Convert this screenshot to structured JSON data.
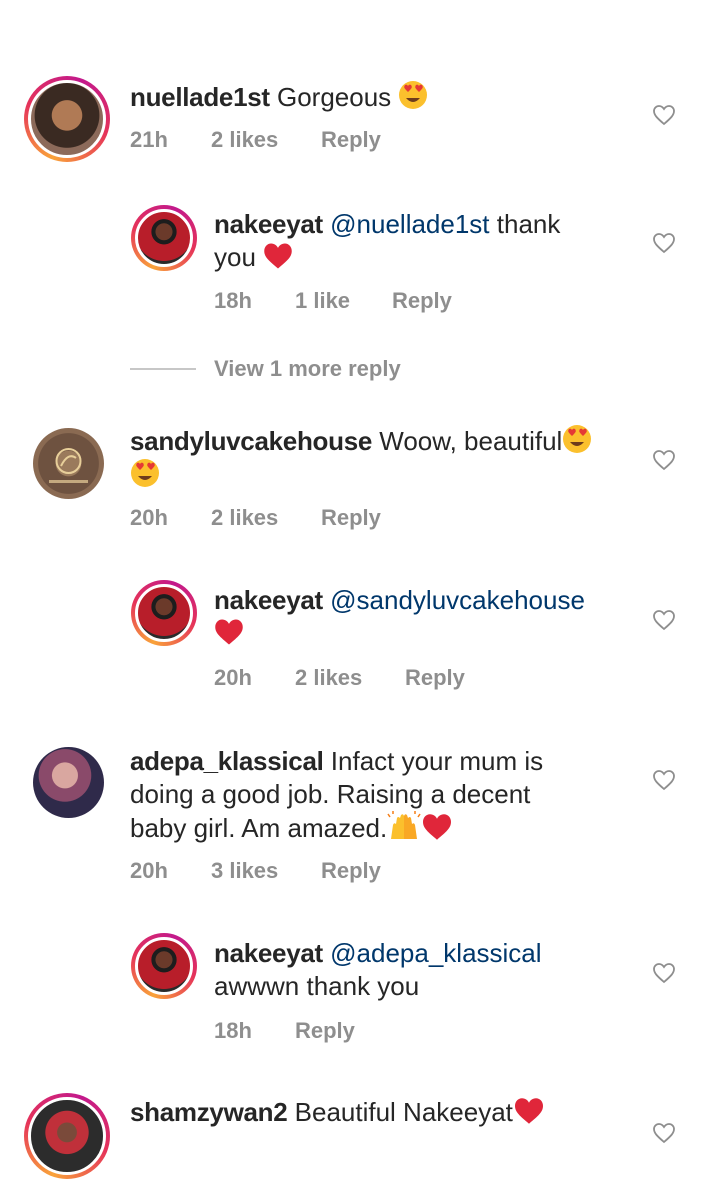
{
  "comments": [
    {
      "username": "nuellade1st",
      "text": "Gorgeous",
      "emoji": "heart-eyes",
      "time": "21h",
      "likes": "2 likes",
      "reply": "Reply",
      "avatar": "user-photo-avatar"
    },
    {
      "username": "nakeeyat",
      "mention": "@nuellade1st",
      "text_line1": "thank",
      "text_line2": "you",
      "emoji": "red-heart",
      "time": "18h",
      "likes": "1 like",
      "reply": "Reply",
      "avatar": "nakeeyat-avatar"
    },
    {
      "username": "sandyluvcakehouse",
      "text": "Woow, beautiful",
      "emoji": "heart-eyes",
      "time": "20h",
      "likes": "2 likes",
      "reply": "Reply",
      "avatar": "logo-avatar"
    },
    {
      "username": "nakeeyat",
      "mention": "@sandyluvcakehouse",
      "emoji": "red-heart",
      "time": "20h",
      "likes": "2 likes",
      "reply": "Reply",
      "avatar": "nakeeyat-avatar"
    },
    {
      "username": "adepa_klassical",
      "text_line1": "Infact your mum is",
      "text_line2": "doing a good job. Raising a decent",
      "text_line3": "baby girl. Am amazed.",
      "emoji": "raising-hands, red-heart",
      "time": "20h",
      "likes": "3 likes",
      "reply": "Reply",
      "avatar": "user-photo-avatar"
    },
    {
      "username": "nakeeyat",
      "mention": "@adepa_klassical",
      "text_line2": "awwwn thank you",
      "time": "18h",
      "reply": "Reply",
      "avatar": "nakeeyat-avatar"
    },
    {
      "username": "shamzywan2",
      "text": "Beautiful Nakeeyat",
      "emoji": "red-heart",
      "avatar": "user-photo-avatar"
    }
  ],
  "view_more": "View 1 more reply",
  "colors": {
    "text": "#262626",
    "meta": "#8e8e8e",
    "mention": "#00376b",
    "heart_red": "#e0263a"
  },
  "icons": {
    "like": "heart-outline-icon"
  }
}
